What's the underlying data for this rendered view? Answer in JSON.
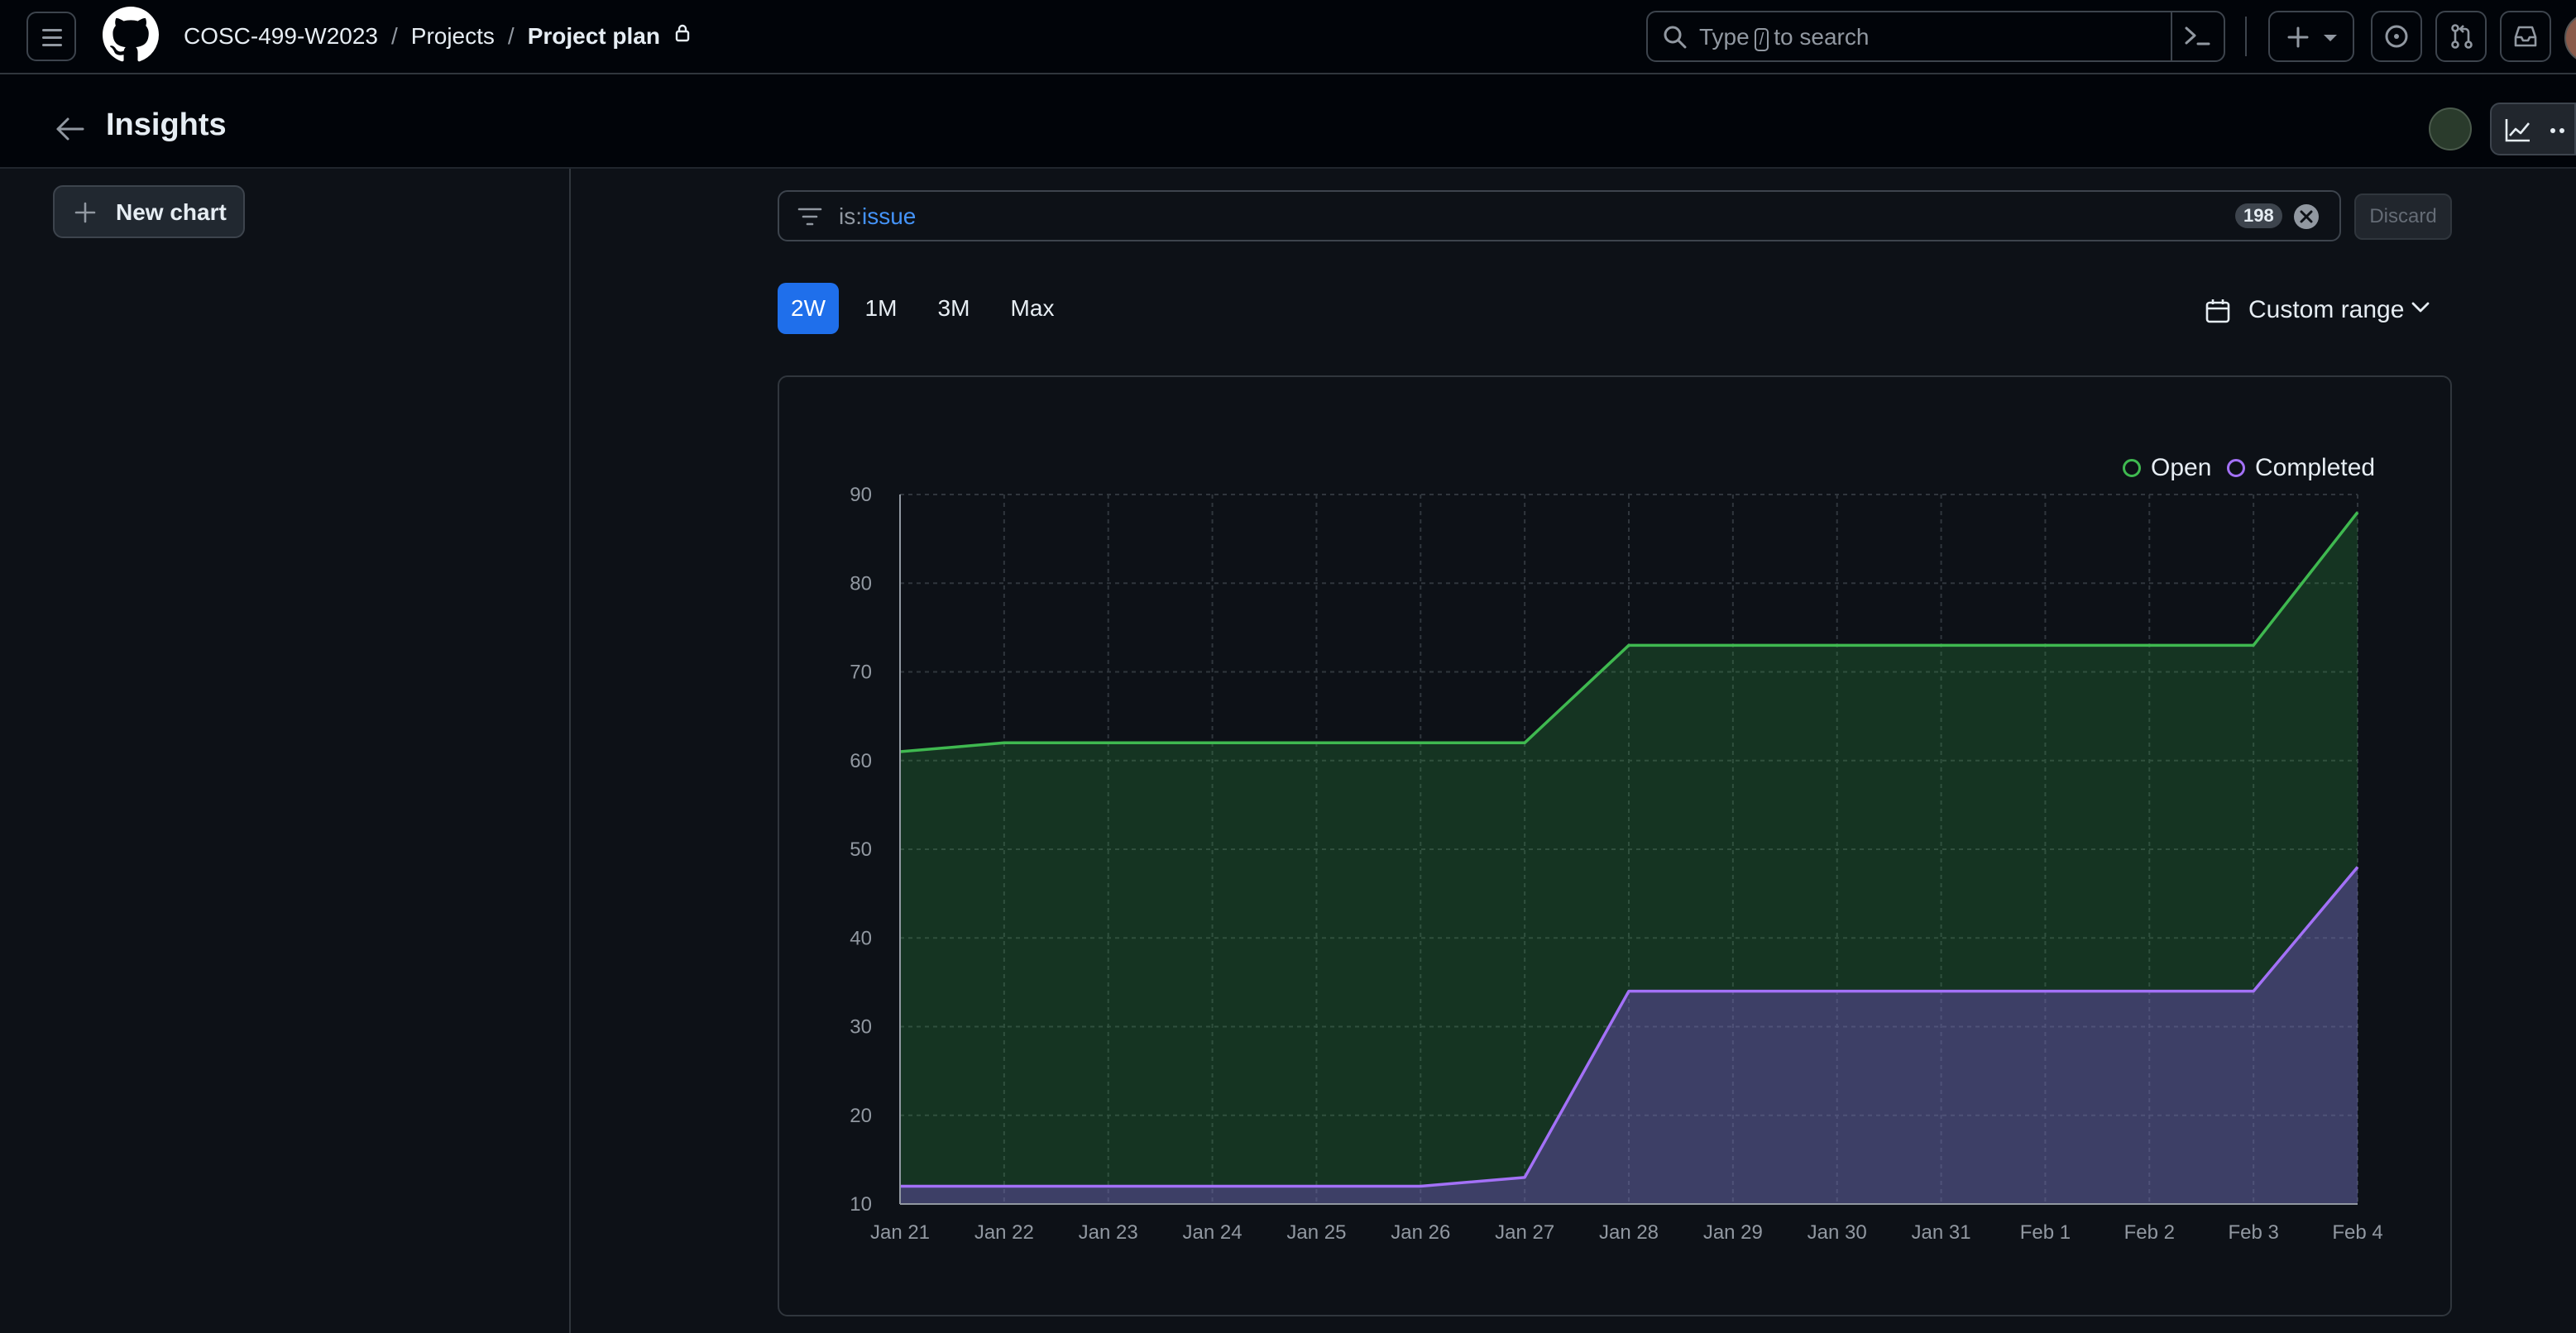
{
  "header": {
    "breadcrumb": {
      "org": "COSC-499-W2023",
      "projects": "Projects",
      "current": "Project plan"
    },
    "search": {
      "prefix": "Type",
      "key": "/",
      "suffix": "to search"
    }
  },
  "page": {
    "title": "Insights"
  },
  "sidebar": {
    "new_chart_label": "New chart"
  },
  "filter": {
    "query_key": "is:",
    "query_value": "issue",
    "count": "198",
    "discard_label": "Discard"
  },
  "ranges": [
    {
      "label": "2W",
      "active": true
    },
    {
      "label": "1M",
      "active": false
    },
    {
      "label": "3M",
      "active": false
    },
    {
      "label": "Max",
      "active": false
    }
  ],
  "custom_range_label": "Custom range",
  "colors": {
    "accent": "#1f6feb",
    "open": "#3fb950",
    "completed": "#a371f7"
  },
  "chart_data": {
    "type": "area",
    "categories": [
      "Jan 21",
      "Jan 22",
      "Jan 23",
      "Jan 24",
      "Jan 25",
      "Jan 26",
      "Jan 27",
      "Jan 28",
      "Jan 29",
      "Jan 30",
      "Jan 31",
      "Feb 1",
      "Feb 2",
      "Feb 3",
      "Feb 4"
    ],
    "series": [
      {
        "name": "Open",
        "color": "#3fb950",
        "values": [
          61,
          62,
          62,
          62,
          62,
          62,
          62,
          73,
          73,
          73,
          73,
          73,
          73,
          73,
          88
        ]
      },
      {
        "name": "Completed",
        "color": "#a371f7",
        "values": [
          12,
          12,
          12,
          12,
          12,
          12,
          13,
          34,
          34,
          34,
          34,
          34,
          34,
          34,
          48
        ]
      }
    ],
    "ylim": [
      10,
      90
    ],
    "yticks": [
      10,
      20,
      30,
      40,
      50,
      60,
      70,
      80,
      90
    ],
    "grid": true,
    "legend": "top-right"
  }
}
